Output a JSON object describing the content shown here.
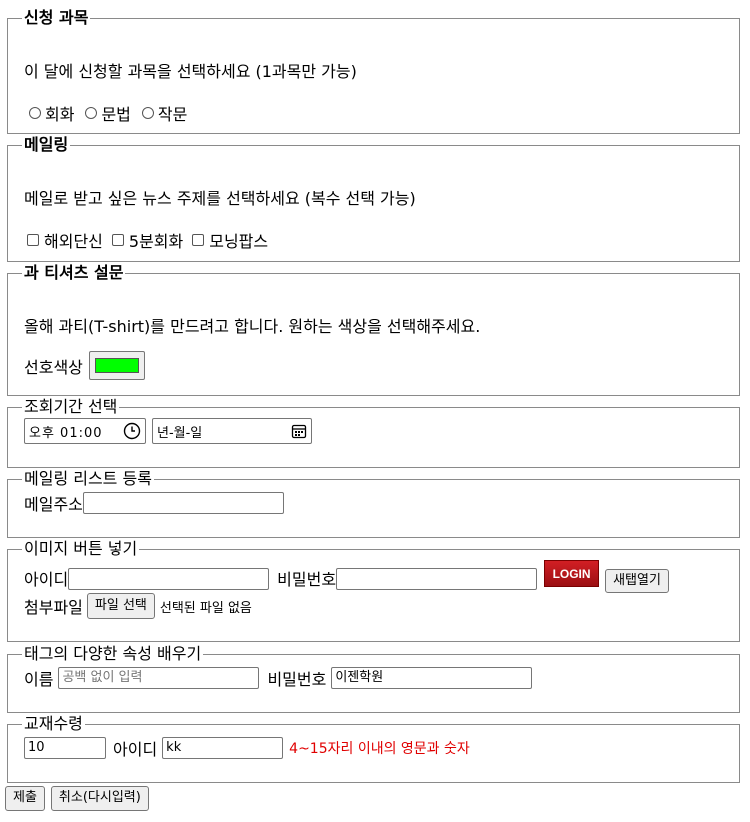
{
  "course": {
    "legend": "신청 과목",
    "description": "이 달에 신청할 과목을 선택하세요 (1과목만 가능)",
    "options": [
      "회화",
      "문법",
      "작문"
    ]
  },
  "mailing": {
    "legend": "메일링",
    "description": "메일로 받고 싶은 뉴스 주제를 선택하세요 (복수 선택 가능)",
    "options": [
      "해외단신",
      "5분회화",
      "모닝팝스"
    ]
  },
  "tshirt": {
    "legend": "과 티셔츠 설문",
    "description": "올해 과티(T-shirt)를 만드려고 합니다. 원하는 색상을 선택해주세요.",
    "color_label": "선호색상",
    "color_value": "#00ff00"
  },
  "period": {
    "legend": "조회기간 선택",
    "time_value": "오후 01:00",
    "date_placeholder": "년-월-일"
  },
  "maillist": {
    "legend": "메일링 리스트 등록",
    "email_label": "메일주소",
    "email_value": ""
  },
  "imagebtn": {
    "legend": "이미지 버튼 넣기",
    "id_label": "아이디",
    "pw_label": "비밀번호",
    "login_text": "LOGIN",
    "newtab_label": "새탭열기",
    "attach_label": "첨부파일",
    "file_button": "파일 선택",
    "file_status": "선택된 파일 없음"
  },
  "attrs": {
    "legend": "태그의 다양한 속성 배우기",
    "name_label": "이름",
    "name_placeholder": "공백 없이 입력",
    "pw_label": "비밀번호",
    "pw_value": "이젠학원"
  },
  "qty": {
    "legend": "교재수령",
    "qty_value": "10",
    "id_label": "아이디",
    "id_value": "kk",
    "hint": "4~15자리 이내의 영문과 숫자"
  },
  "actions": {
    "submit": "제출",
    "reset": "취소(다시입력)"
  }
}
